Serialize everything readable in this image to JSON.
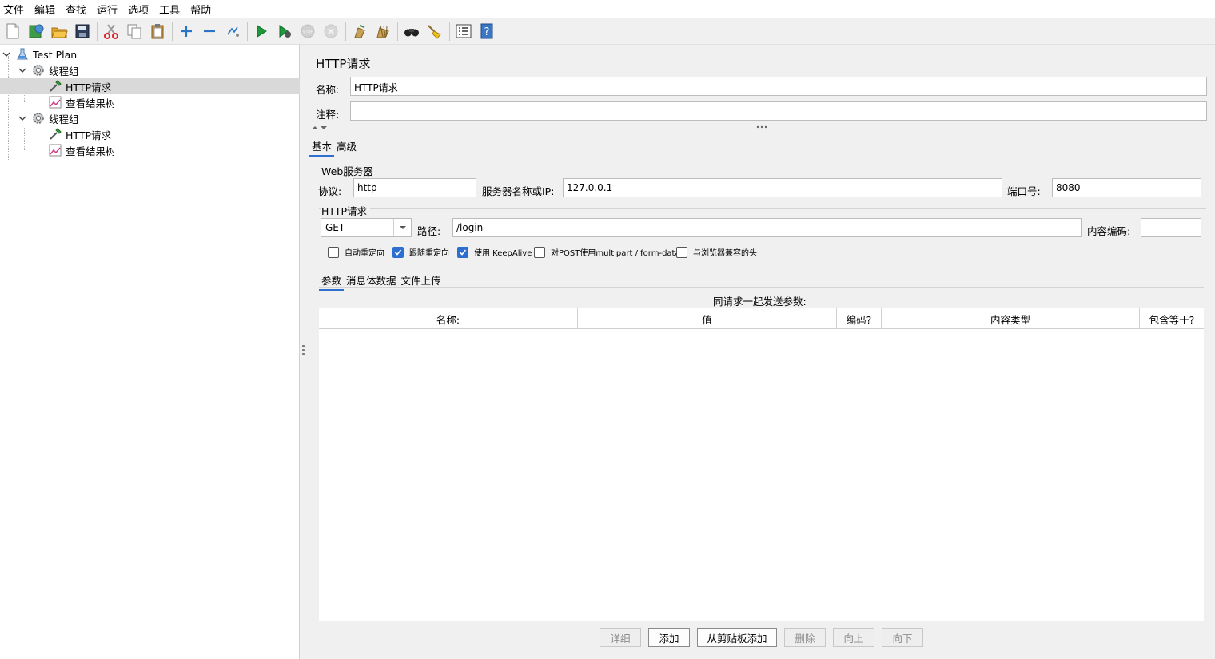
{
  "menu": [
    "文件",
    "编辑",
    "查找",
    "运行",
    "选项",
    "工具",
    "帮助"
  ],
  "toolbar": [
    "new-icon",
    "templates-icon",
    "open-icon",
    "save-icon",
    "cut-icon",
    "copy-icon",
    "paste-icon",
    "expand-icon",
    "collapse-icon",
    "toggle-icon",
    "start-icon",
    "start-no-pause-icon",
    "stop-icon",
    "shutdown-icon",
    "clear-icon",
    "clear-all-icon",
    "search-icon",
    "reset-search-icon",
    "function-helper-icon",
    "help-icon"
  ],
  "tree": {
    "test_plan": "Test Plan",
    "thread_group_1": "线程组",
    "http_request_1": "HTTP请求",
    "view_results_1": "查看结果树",
    "thread_group_2": "线程组",
    "http_request_2": "HTTP请求",
    "view_results_2": "查看结果树"
  },
  "panel": {
    "title": "HTTP请求",
    "name_label": "名称:",
    "name_value": "HTTP请求",
    "comment_label": "注释:",
    "comment_value": "",
    "tabs": [
      "基本",
      "高级"
    ],
    "web_server": {
      "title": "Web服务器",
      "protocol_label": "协议:",
      "protocol_value": "http",
      "server_label": "服务器名称或IP:",
      "server_value": "127.0.0.1",
      "port_label": "端口号:",
      "port_value": "8080"
    },
    "http_request": {
      "title": "HTTP请求",
      "method": "GET",
      "path_label": "路径:",
      "path_value": "/login",
      "encoding_label": "内容编码:",
      "encoding_value": ""
    },
    "checkboxes": [
      {
        "label": "自动重定向",
        "checked": false
      },
      {
        "label": "跟随重定向",
        "checked": true
      },
      {
        "label": "使用 KeepAlive",
        "checked": true
      },
      {
        "label": "对POST使用multipart / form-data",
        "checked": false
      },
      {
        "label": "与浏览器兼容的头",
        "checked": false
      }
    ],
    "sub_tabs": [
      "参数",
      "消息体数据",
      "文件上传"
    ],
    "params_caption": "同请求一起发送参数:",
    "columns": [
      "名称:",
      "值",
      "编码?",
      "内容类型",
      "包含等于?"
    ],
    "buttons": {
      "detail": "详细",
      "add": "添加",
      "add_clipboard": "从剪贴板添加",
      "delete": "删除",
      "up": "向上",
      "down": "向下"
    }
  }
}
